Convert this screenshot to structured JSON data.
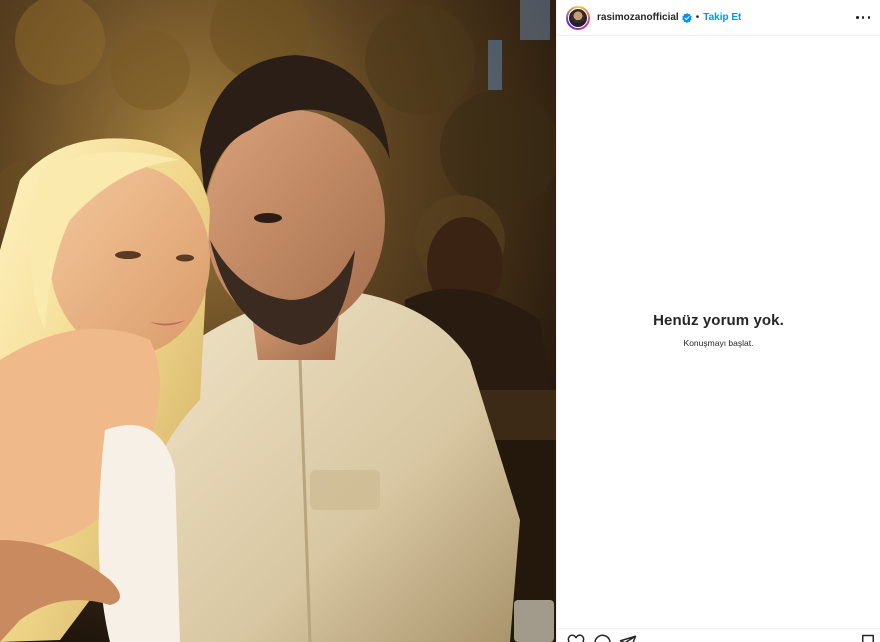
{
  "header": {
    "username": "rasimozanofficial",
    "separator": "•",
    "follow_label": "Takip Et",
    "more_icon": "more-horizontal-icon",
    "verified_icon": "verified-badge-icon"
  },
  "comments": {
    "empty_title": "Henüz yorum yok.",
    "empty_subtitle": "Konuşmayı başlat."
  },
  "actions": {
    "icons": [
      "heart-icon",
      "comment-icon",
      "share-icon",
      "bookmark-icon"
    ]
  },
  "colors": {
    "accent": "#0095f6",
    "text": "#262626",
    "divider": "#efefef"
  }
}
